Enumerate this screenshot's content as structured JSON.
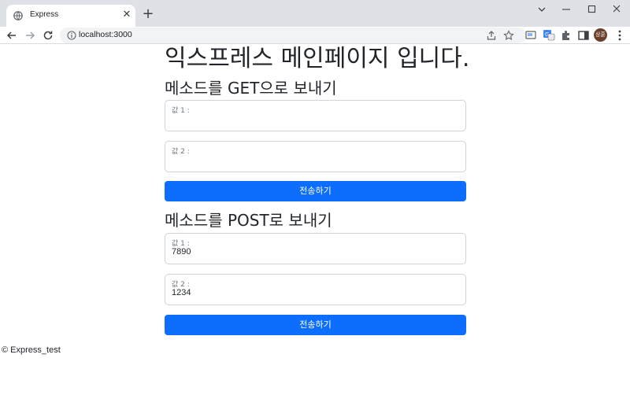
{
  "browser": {
    "tab_title": "Express",
    "url": "localhost:3000",
    "profile_label": "상훈"
  },
  "page": {
    "title": "익스프레스 메인페이지 입니다.",
    "get_section": {
      "heading": "메소드를 GET으로 보내기",
      "field1": {
        "label": "값 1 :",
        "value": ""
      },
      "field2": {
        "label": "값 2 :",
        "value": ""
      },
      "submit_label": "전송하기"
    },
    "post_section": {
      "heading": "메소드를 POST로 보내기",
      "field1": {
        "label": "값 1 :",
        "value": "7890"
      },
      "field2": {
        "label": "값 2 :",
        "value": "1234"
      },
      "submit_label": "전송하기"
    },
    "footer": "© Express_test"
  },
  "colors": {
    "primary": "#0d6efd",
    "chrome": "#dee1e6"
  }
}
